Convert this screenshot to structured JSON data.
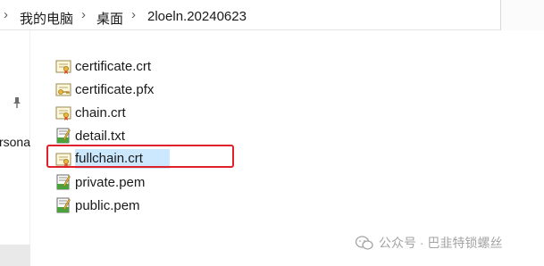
{
  "breadcrumb": {
    "items": [
      "我的电脑",
      "桌面",
      "2loeln.20240623"
    ],
    "separator": "›"
  },
  "nav_pane": {
    "partial_label": "rsona",
    "pin_icon": "pin-icon"
  },
  "files": [
    {
      "name": "certificate.crt",
      "icon": "certificate-icon",
      "selected": false
    },
    {
      "name": "certificate.pfx",
      "icon": "pfx-certificate-icon",
      "selected": false
    },
    {
      "name": "chain.crt",
      "icon": "certificate-icon",
      "selected": false
    },
    {
      "name": "detail.txt",
      "icon": "text-file-icon",
      "selected": false
    },
    {
      "name": "fullchain.crt",
      "icon": "certificate-icon",
      "selected": true
    },
    {
      "name": "private.pem",
      "icon": "text-file-icon",
      "selected": false
    },
    {
      "name": "public.pem",
      "icon": "text-file-icon",
      "selected": false
    }
  ],
  "annotation": {
    "color": "#e0202a"
  },
  "watermark": {
    "text": "公众号 · 巴韭特锁螺丝",
    "icon": "wechat-icon"
  },
  "colors": {
    "selection": "#cce8ff",
    "highlight": "#e0202a"
  }
}
